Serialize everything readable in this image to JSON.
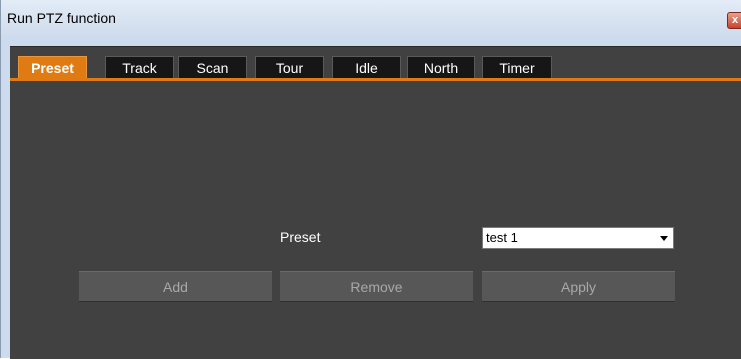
{
  "window": {
    "title": "Run PTZ function",
    "close_glyph": "x"
  },
  "tabs": [
    {
      "label": "Preset",
      "active": true
    },
    {
      "label": "Track",
      "active": false
    },
    {
      "label": "Scan",
      "active": false
    },
    {
      "label": "Tour",
      "active": false
    },
    {
      "label": "Idle",
      "active": false
    },
    {
      "label": "North",
      "active": false
    },
    {
      "label": "Timer",
      "active": false
    }
  ],
  "preset_panel": {
    "label": "Preset",
    "selected_value": "test 1",
    "buttons": {
      "add": "Add",
      "remove": "Remove",
      "apply": "Apply"
    }
  },
  "colors": {
    "accent": "#e07b14",
    "panel_bg": "#414141",
    "tab_bg": "#161616",
    "button_bg": "#575757",
    "button_text": "#a8a8a8"
  }
}
